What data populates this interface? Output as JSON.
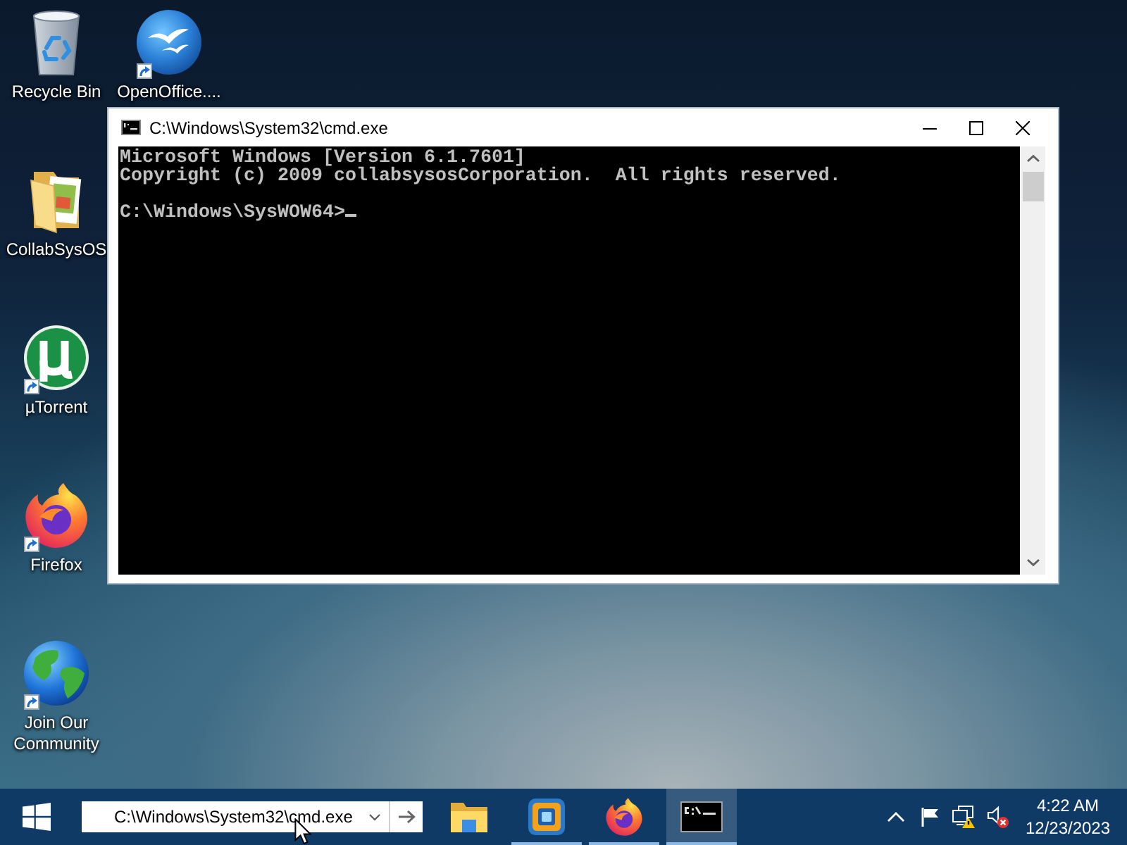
{
  "desktop": {
    "rows": [
      {
        "icons": [
          {
            "label": "Recycle Bin",
            "kind": "recycle-bin",
            "shortcut": false
          },
          {
            "label": "OpenOffice....",
            "kind": "openoffice",
            "shortcut": true
          }
        ]
      },
      {
        "icons": [
          {
            "label": "CollabSysOS",
            "kind": "folder",
            "shortcut": false
          }
        ]
      },
      {
        "icons": [
          {
            "label": "µTorrent",
            "kind": "utorrent",
            "shortcut": true
          }
        ]
      },
      {
        "icons": [
          {
            "label": "Firefox",
            "kind": "firefox",
            "shortcut": true
          }
        ]
      },
      {
        "icons": [
          {
            "label": "Join Our Community",
            "kind": "globe",
            "shortcut": true
          }
        ]
      }
    ]
  },
  "window": {
    "title": "C:\\Windows\\System32\\cmd.exe",
    "console": {
      "lines": [
        "Microsoft Windows [Version 6.1.7601]",
        "Copyright (c) 2009 collabsysosCorporation.  All rights reserved."
      ],
      "prompt": "C:\\Windows\\SysWOW64>"
    }
  },
  "taskbar": {
    "address": {
      "value": "C:\\Windows\\System32\\cmd.exe"
    },
    "apps": [
      {
        "kind": "explorer",
        "running": false,
        "selected": false
      },
      {
        "kind": "vmware",
        "running": true,
        "selected": false
      },
      {
        "kind": "firefox",
        "running": true,
        "selected": false
      },
      {
        "kind": "cmd",
        "running": true,
        "selected": true
      }
    ],
    "clock": {
      "time": "4:22 AM",
      "date": "12/23/2023"
    }
  }
}
